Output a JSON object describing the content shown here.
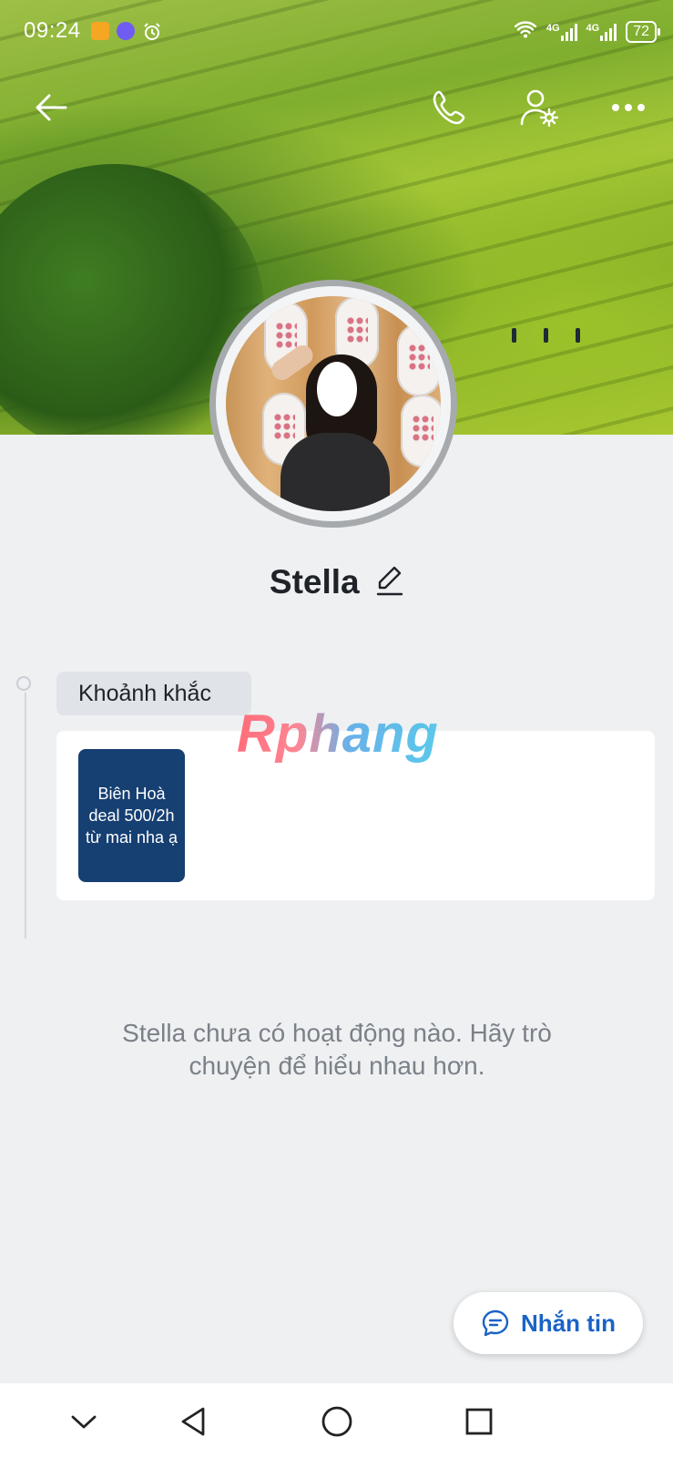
{
  "status_bar": {
    "time": "09:24",
    "network_1": "4G",
    "network_2": "4G",
    "battery": "72",
    "colors": {
      "notif_1": "#f5a623",
      "notif_2": "#6f5cf2"
    }
  },
  "top_bar": {
    "icons": [
      "back-arrow-icon",
      "phone-icon",
      "user-settings-icon",
      "more-icon"
    ]
  },
  "profile": {
    "name": "Stella"
  },
  "moments": {
    "label": "Khoảnh khắc",
    "notes": [
      {
        "text": "Biên Hoà deal 500/2h từ mai nha ạ",
        "color": "#163f72"
      }
    ]
  },
  "watermark": "Rphang",
  "empty_state": {
    "text": "Stella chưa có hoạt động nào. Hãy trò chuyện để hiểu nhau hơn."
  },
  "actions": {
    "message_label": "Nhắn tin",
    "accent": "#1a63c6"
  },
  "nav_bar": {
    "icons": [
      "chevron-down-icon",
      "back-triangle-icon",
      "home-circle-icon",
      "recents-square-icon"
    ]
  }
}
